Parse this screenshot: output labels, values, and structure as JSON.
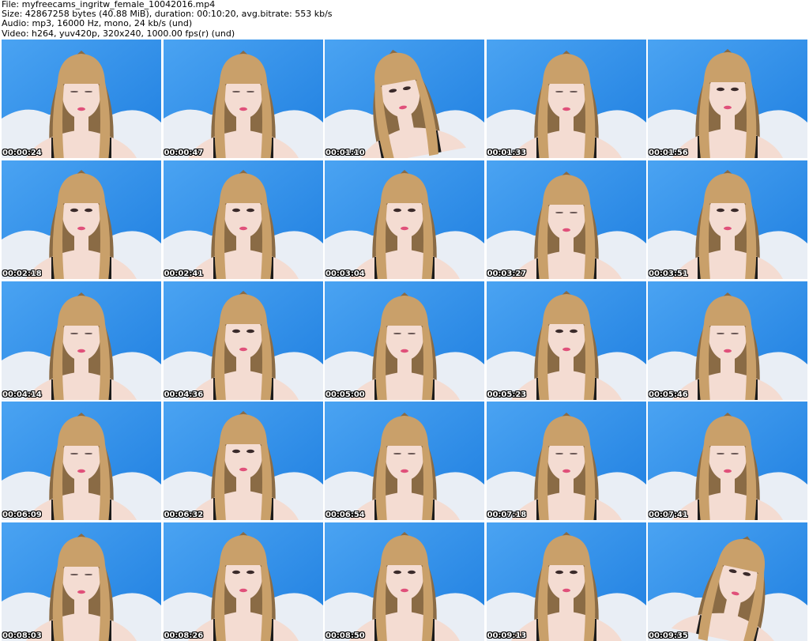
{
  "header": {
    "file_line": "File: myfreecams_ingritw_female_10042016.mp4",
    "size_line": "Size: 42867258 bytes (40.88 MiB), duration: 00:10:20, avg.bitrate: 553 kb/s",
    "audio_line": "Audio: mp3, 16000 Hz, mono, 24 kb/s (und)",
    "video_line": "Video: h264, yuv420p, 320x240, 1000.00 fps(r) (und)"
  },
  "colors": {
    "background_wall": "#1f7fe0",
    "wall_highlight": "#4aa3f2",
    "pillow": "#e9eef5",
    "hair": "#c9a06a",
    "hair_shadow": "#8a6b45",
    "skin": "#f4dcd2",
    "top": "#1b1b1b",
    "lips": "#e0507a"
  },
  "thumbnails": [
    {
      "timestamp": "00:00:24",
      "pose": "down"
    },
    {
      "timestamp": "00:00:47",
      "pose": "down"
    },
    {
      "timestamp": "00:01:10",
      "pose": "tilt"
    },
    {
      "timestamp": "00:01:33",
      "pose": "down"
    },
    {
      "timestamp": "00:01:56",
      "pose": "front"
    },
    {
      "timestamp": "00:02:18",
      "pose": "front"
    },
    {
      "timestamp": "00:02:41",
      "pose": "front"
    },
    {
      "timestamp": "00:03:04",
      "pose": "front"
    },
    {
      "timestamp": "00:03:27",
      "pose": "down"
    },
    {
      "timestamp": "00:03:51",
      "pose": "front"
    },
    {
      "timestamp": "00:04:14",
      "pose": "down"
    },
    {
      "timestamp": "00:04:36",
      "pose": "front"
    },
    {
      "timestamp": "00:05:00",
      "pose": "down"
    },
    {
      "timestamp": "00:05:23",
      "pose": "front"
    },
    {
      "timestamp": "00:05:46",
      "pose": "down"
    },
    {
      "timestamp": "00:06:09",
      "pose": "down"
    },
    {
      "timestamp": "00:06:32",
      "pose": "front"
    },
    {
      "timestamp": "00:06:54",
      "pose": "down"
    },
    {
      "timestamp": "00:07:18",
      "pose": "down"
    },
    {
      "timestamp": "00:07:41",
      "pose": "down"
    },
    {
      "timestamp": "00:08:03",
      "pose": "down"
    },
    {
      "timestamp": "00:08:26",
      "pose": "front"
    },
    {
      "timestamp": "00:08:50",
      "pose": "front"
    },
    {
      "timestamp": "00:09:13",
      "pose": "front"
    },
    {
      "timestamp": "00:09:35",
      "pose": "side"
    }
  ]
}
